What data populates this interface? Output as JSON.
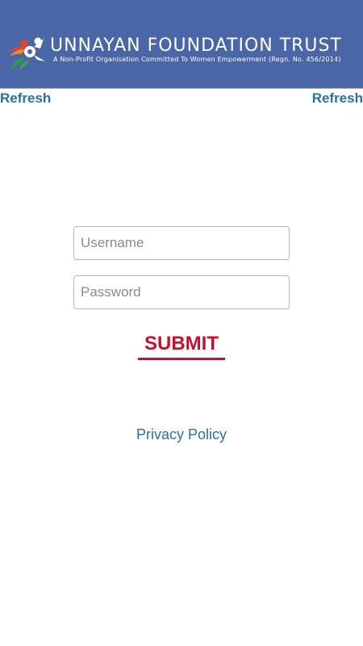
{
  "header": {
    "title": "UNNAYAN FOUNDATION TRUST",
    "subtitle": "A Non-Profit Organisation Committed To Women Empowerment (Regn. No. 456/2014)",
    "logo_icon": "unnayan-foundation-logo",
    "background_color": "#4a66a6"
  },
  "toolbar": {
    "refresh_left": "Refresh",
    "refresh_right": "Refresh",
    "link_color": "#2b6fa3"
  },
  "form": {
    "username_placeholder": "Username",
    "username_value": "",
    "password_placeholder": "Password",
    "password_value": "",
    "submit_label": "SUBMIT",
    "submit_color": "#c8102e"
  },
  "footer": {
    "privacy_label": "Privacy Policy"
  }
}
